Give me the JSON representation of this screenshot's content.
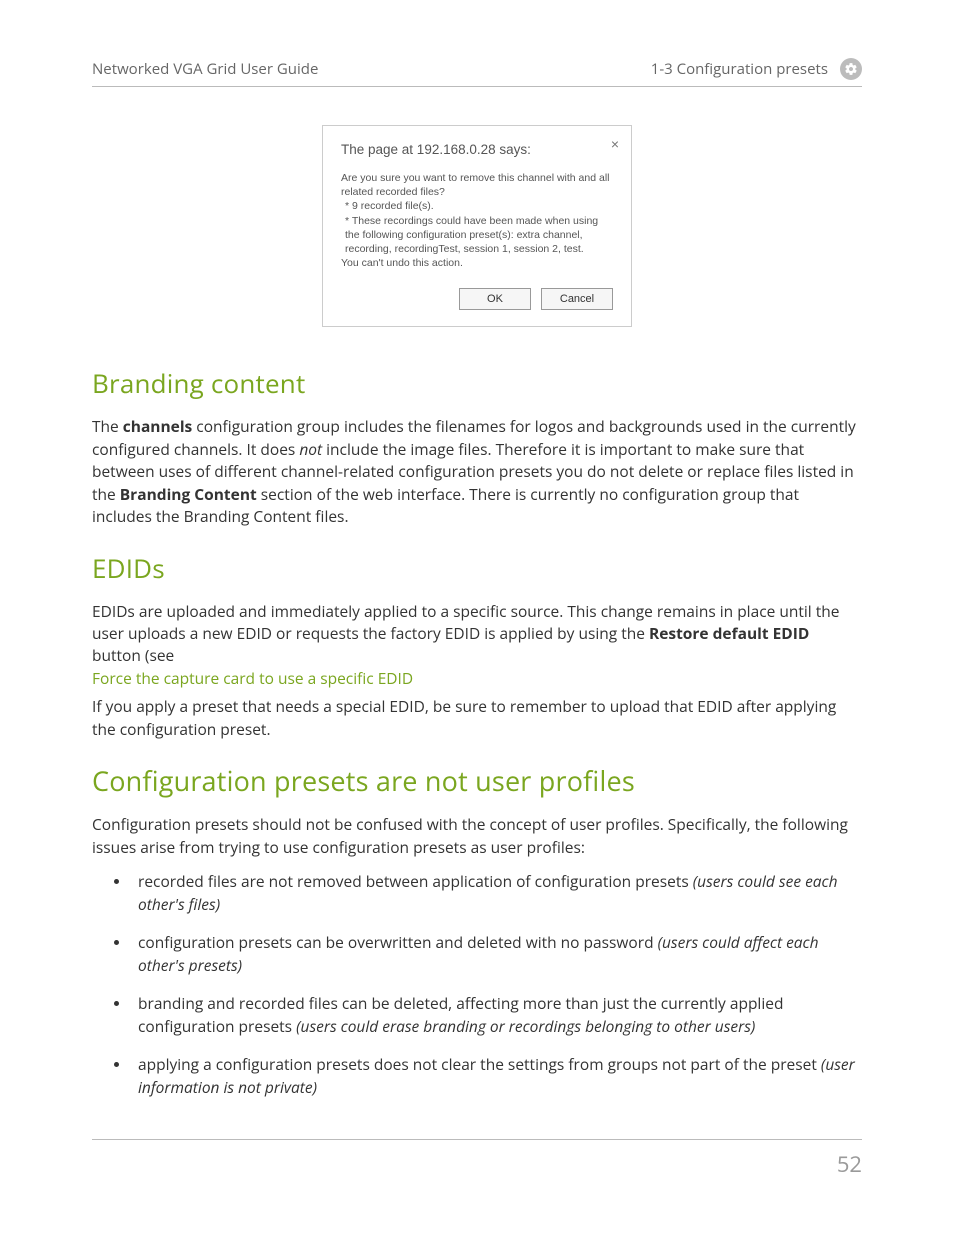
{
  "header": {
    "left": "Networked VGA Grid User Guide",
    "right": "1-3 Configuration presets"
  },
  "dialog": {
    "title": "The page at 192.168.0.28 says:",
    "close": "×",
    "line1": "Are you sure you want to remove this channel with and all related recorded files?",
    "line2": "* 9 recorded file(s).",
    "line3": "* These recordings could have been made when using the following configuration preset(s): extra channel, recording, recordingTest, session 1, session 2, test.",
    "line4": "You can't undo this action.",
    "ok": "OK",
    "cancel": "Cancel"
  },
  "branding": {
    "heading": "Branding content",
    "p1a": "The ",
    "p1b": "channels",
    "p1c": " configuration group includes the filenames for logos and backgrounds used in the currently configured channels. It does ",
    "p1d": "not",
    "p1e": " include the image files. Therefore it is important to make sure that between uses of different channel-related configuration presets you do not delete or replace files listed in the ",
    "p1f": "Branding Content",
    "p1g": " section of the web interface. There is currently no configuration group that includes the Branding Content files."
  },
  "edids": {
    "heading": "EDIDs",
    "p1a": "EDIDs are uploaded and immediately applied to a specific source. This change remains in place until the user uploads a new EDID or requests the factory EDID is applied by using the ",
    "p1b": "Restore default EDID",
    "p1c": " button (see ",
    "link": "Force the capture card to use a specific EDID",
    "p2": "If you apply a preset that needs a special EDID, be sure to remember to upload that EDID after applying the configuration preset."
  },
  "config": {
    "heading": "Configuration presets are not user profiles",
    "intro": "Configuration presets should not be confused with the concept of user profiles. Specifically, the following issues arise from trying to use configuration presets as user profiles:",
    "b1a": "recorded files are not removed between application of configuration presets ",
    "b1b": "(users could see each other's files)",
    "b2a": "configuration presets can be overwritten and deleted with no password ",
    "b2b": "(users could affect each other's presets)",
    "b3a": "branding and recorded files can be deleted, affecting more than just the currently applied configuration presets ",
    "b3b": "(users could erase branding or recordings belonging to other users)",
    "b4a": "applying a configuration presets does not clear the settings from groups not part of the preset ",
    "b4b": "(user information is not private)"
  },
  "pageNumber": "52"
}
